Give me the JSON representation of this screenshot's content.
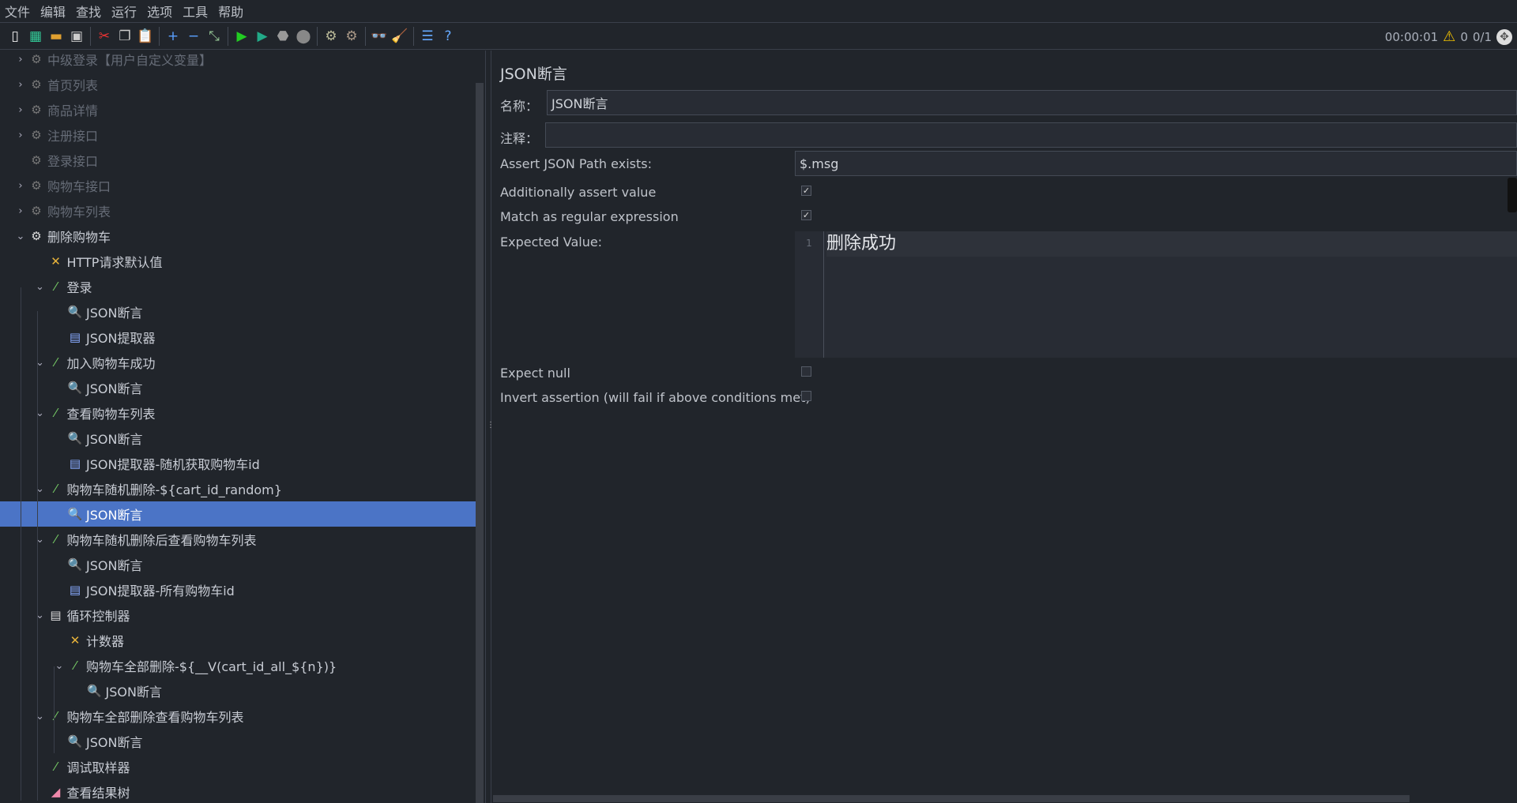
{
  "menu": [
    "文件",
    "编辑",
    "查找",
    "运行",
    "选项",
    "工具",
    "帮助"
  ],
  "toolbar": [
    {
      "icon": "new-icon",
      "glyph": "▯",
      "color": "#eee"
    },
    {
      "icon": "templates-icon",
      "glyph": "▦",
      "color": "#3c9"
    },
    {
      "icon": "open-icon",
      "glyph": "▬",
      "color": "#e0a030"
    },
    {
      "icon": "save-icon",
      "glyph": "▣",
      "color": "#ccc"
    },
    "sep",
    {
      "icon": "cut-icon",
      "glyph": "✂",
      "color": "#e33"
    },
    {
      "icon": "copy-icon",
      "glyph": "❐",
      "color": "#ccc"
    },
    {
      "icon": "paste-icon",
      "glyph": "📋",
      "color": "#c96"
    },
    "sep",
    {
      "icon": "expand-icon",
      "glyph": "+",
      "color": "#5aa0ff"
    },
    {
      "icon": "collapse-icon",
      "glyph": "−",
      "color": "#5aa0ff"
    },
    {
      "icon": "toggle-icon",
      "glyph": "⤡",
      "color": "#9c9"
    },
    "sep",
    {
      "icon": "start-icon",
      "glyph": "▶",
      "color": "#2c2"
    },
    {
      "icon": "start-no-pause-icon",
      "glyph": "▶",
      "color": "#2a8"
    },
    {
      "icon": "stop-icon",
      "glyph": "⬣",
      "color": "#999"
    },
    {
      "icon": "shutdown-icon",
      "glyph": "⬤",
      "color": "#888"
    },
    "sep",
    {
      "icon": "clear-icon",
      "glyph": "⚙",
      "color": "#bb9"
    },
    {
      "icon": "clear-all-icon",
      "glyph": "⚙",
      "color": "#a98"
    },
    "sep",
    {
      "icon": "search-icon",
      "glyph": "👓",
      "color": "#bbb"
    },
    {
      "icon": "reset-search-icon",
      "glyph": "🧹",
      "color": "#fc3"
    },
    "sep",
    {
      "icon": "function-helper-icon",
      "glyph": "☰",
      "color": "#6af"
    },
    {
      "icon": "help-icon",
      "glyph": "?",
      "color": "#6af"
    }
  ],
  "status": {
    "elapsed": "00:00:01",
    "warnings": "0",
    "threads": "0/1",
    "warning_color": "#f2c200"
  },
  "tree": [
    {
      "level": 0,
      "exp": "closed",
      "icon": "gear-icon",
      "label": "中级登录【用户自定义变量】",
      "disabled": true
    },
    {
      "level": 0,
      "exp": "closed",
      "icon": "gear-icon",
      "label": "首页列表",
      "disabled": true
    },
    {
      "level": 0,
      "exp": "closed",
      "icon": "gear-icon",
      "label": "商品详情",
      "disabled": true
    },
    {
      "level": 0,
      "exp": "closed",
      "icon": "gear-icon",
      "label": "注册接口",
      "disabled": true
    },
    {
      "level": 0,
      "exp": "none",
      "icon": "gear-icon",
      "label": "登录接口",
      "disabled": true
    },
    {
      "level": 0,
      "exp": "closed",
      "icon": "gear-icon",
      "label": "购物车接口",
      "disabled": true
    },
    {
      "level": 0,
      "exp": "closed",
      "icon": "gear-icon",
      "label": "购物车列表",
      "disabled": true
    },
    {
      "level": 0,
      "exp": "open",
      "icon": "gear-icon",
      "label": "删除购物车"
    },
    {
      "level": 1,
      "exp": "none",
      "icon": "wrench-icon",
      "label": "HTTP请求默认值"
    },
    {
      "level": 1,
      "exp": "open",
      "icon": "pipette-icon",
      "label": "登录"
    },
    {
      "level": 2,
      "exp": "none",
      "icon": "magnifier-icon",
      "label": "JSON断言"
    },
    {
      "level": 2,
      "exp": "none",
      "icon": "extractor-icon",
      "label": "JSON提取器"
    },
    {
      "level": 1,
      "exp": "open",
      "icon": "pipette-icon",
      "label": "加入购物车成功"
    },
    {
      "level": 2,
      "exp": "none",
      "icon": "magnifier-icon",
      "label": "JSON断言"
    },
    {
      "level": 1,
      "exp": "open",
      "icon": "pipette-icon",
      "label": "查看购物车列表"
    },
    {
      "level": 2,
      "exp": "none",
      "icon": "magnifier-icon",
      "label": "JSON断言"
    },
    {
      "level": 2,
      "exp": "none",
      "icon": "extractor-icon",
      "label": "JSON提取器-随机获取购物车id"
    },
    {
      "level": 1,
      "exp": "open",
      "icon": "pipette-icon",
      "label": "购物车随机删除-${cart_id_random}"
    },
    {
      "level": 2,
      "exp": "none",
      "icon": "magnifier-icon",
      "label": "JSON断言",
      "selected": true
    },
    {
      "level": 1,
      "exp": "open",
      "icon": "pipette-icon",
      "label": "购物车随机删除后查看购物车列表"
    },
    {
      "level": 2,
      "exp": "none",
      "icon": "magnifier-icon",
      "label": "JSON断言"
    },
    {
      "level": 2,
      "exp": "none",
      "icon": "extractor-icon",
      "label": "JSON提取器-所有购物车id"
    },
    {
      "level": 1,
      "exp": "open",
      "icon": "loop-icon",
      "label": "循环控制器"
    },
    {
      "level": 2,
      "exp": "none",
      "icon": "wrench-icon",
      "label": "计数器"
    },
    {
      "level": 2,
      "exp": "open",
      "icon": "pipette-icon",
      "label": "购物车全部删除-${__V(cart_id_all_${n})}"
    },
    {
      "level": 3,
      "exp": "none",
      "icon": "magnifier-icon",
      "label": "JSON断言"
    },
    {
      "level": 1,
      "exp": "open",
      "icon": "pipette-icon",
      "label": "购物车全部删除查看购物车列表"
    },
    {
      "level": 2,
      "exp": "none",
      "icon": "magnifier-icon",
      "label": "JSON断言"
    },
    {
      "level": 1,
      "exp": "none",
      "icon": "pipette-icon",
      "label": "调试取样器"
    },
    {
      "level": 1,
      "exp": "none",
      "icon": "chart-icon",
      "label": "查看结果树"
    }
  ],
  "panel": {
    "title": "JSON断言",
    "name_label": "名称：",
    "name_value": "JSON断言",
    "comment_label": "注释：",
    "comment_value": "",
    "path_label": "Assert JSON Path exists:",
    "path_value": "$.msg",
    "assert_value_label": "Additionally assert value",
    "assert_value_checked": true,
    "regex_label": "Match as regular expression",
    "regex_checked": true,
    "expected_label": "Expected Value:",
    "expected_line": "1",
    "expected_value": "删除成功",
    "null_label": "Expect null",
    "null_checked": false,
    "invert_label": "Invert assertion (will fail if above conditions met)",
    "invert_checked": false
  },
  "selection_color": "#4b74c6"
}
